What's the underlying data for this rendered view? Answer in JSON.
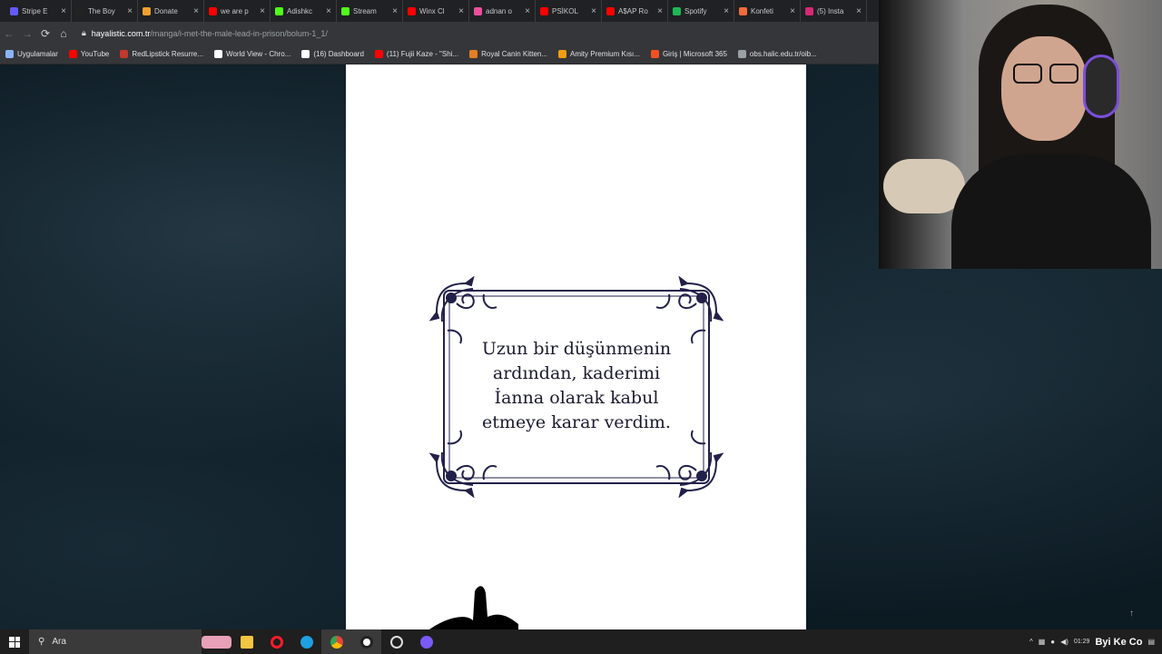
{
  "browser": {
    "tabs": [
      {
        "title": "Stripe E",
        "color": "#635bff"
      },
      {
        "title": "The Boy",
        "color": "#222222"
      },
      {
        "title": "Donate",
        "color": "#f0a030"
      },
      {
        "title": "we are p",
        "color": "#ff0000"
      },
      {
        "title": "Adishkc",
        "color": "#53fc18"
      },
      {
        "title": "Stream",
        "color": "#53fc18"
      },
      {
        "title": "Winx Cl",
        "color": "#ff0000"
      },
      {
        "title": "adnan o",
        "color": "#e94f9c"
      },
      {
        "title": "PSİKOL",
        "color": "#ff0000"
      },
      {
        "title": "A$AP Ro",
        "color": "#ff0000"
      },
      {
        "title": "Spotify",
        "color": "#1db954"
      },
      {
        "title": "Konfeti",
        "color": "#f26b3a"
      },
      {
        "title": "(5) Insta",
        "color": "#d62976"
      }
    ],
    "close_glyph": "×",
    "url": {
      "domain": "hayalistic.com.tr",
      "path": "/manga/i-met-the-male-lead-in-prison/bolum-1_1/"
    },
    "bookmarks": [
      {
        "label": "Uygulamalar",
        "color": "#8ab4f8"
      },
      {
        "label": "YouTube",
        "color": "#ff0000"
      },
      {
        "label": "RedLipstick Resurre...",
        "color": "#c0392b"
      },
      {
        "label": "World View - Chro...",
        "color": "#ffffff"
      },
      {
        "label": "(16) Dashboard",
        "color": "#ffffff"
      },
      {
        "label": "(11) Fujii Kaze - \"Shi...",
        "color": "#ff0000"
      },
      {
        "label": "Royal Canin Kitten...",
        "color": "#e67e22"
      },
      {
        "label": "Amity Premium Kısı...",
        "color": "#f39c12"
      },
      {
        "label": "Giriş | Microsoft 365",
        "color": "#f25022"
      },
      {
        "label": "obs.halic.edu.tr/oib...",
        "color": "#9aa0a6"
      }
    ]
  },
  "page": {
    "caption_lines": [
      "Uzun bir düşünmenin",
      "ardından, kaderimi",
      "İanna olarak kabul",
      "etmeye karar verdim."
    ]
  },
  "taskbar": {
    "search_label": "Ara",
    "clock_time": "01:29",
    "clock_date": "",
    "watermark": "Byi Ke Co"
  },
  "colors": {
    "frame_ink": "#22204a",
    "page_bg": "#ffffff",
    "taskbar_bg": "#1f1f1f"
  }
}
